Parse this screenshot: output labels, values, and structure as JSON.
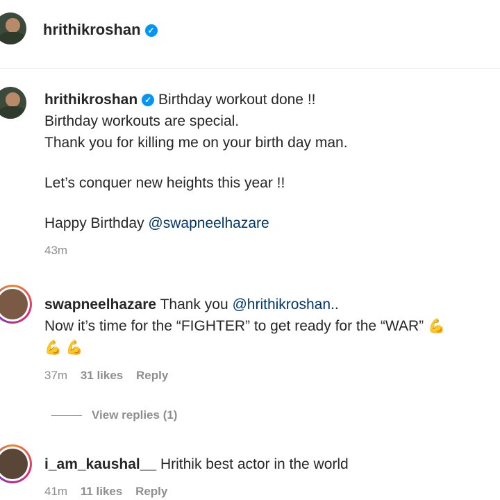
{
  "header": {
    "username": "hrithikroshan",
    "verified": true
  },
  "caption": {
    "username": "hrithikroshan",
    "line1": "Birthday workout done !!",
    "line2": "Birthday workouts are special.",
    "line3": "Thank you for killing me on your birth day man.",
    "line4": "Let’s conquer new heights this year !!",
    "line5_prefix": "Happy Birthday ",
    "line5_mention": "@swapneelhazare",
    "time": "43m"
  },
  "comments": [
    {
      "username": "swapneelhazare",
      "text_prefix": "Thank you ",
      "mention": "@hrithikroshan",
      "text_suffix": "..",
      "line2": "Now it’s time for the “FIGHTER” to get ready for the “WAR”",
      "emoji_inline": "💪",
      "emoji_line3": "💪 💪",
      "time": "37m",
      "likes": "31 likes",
      "reply": "Reply",
      "view_replies": "View replies (1)"
    },
    {
      "username": "i_am_kaushal__",
      "text": "Hrithik best actor in the world",
      "time": "41m",
      "likes": "11 likes",
      "reply": "Reply"
    }
  ],
  "colors": {
    "verified": "#0095f6",
    "mention": "#00376b",
    "meta": "#8e8e8e"
  }
}
